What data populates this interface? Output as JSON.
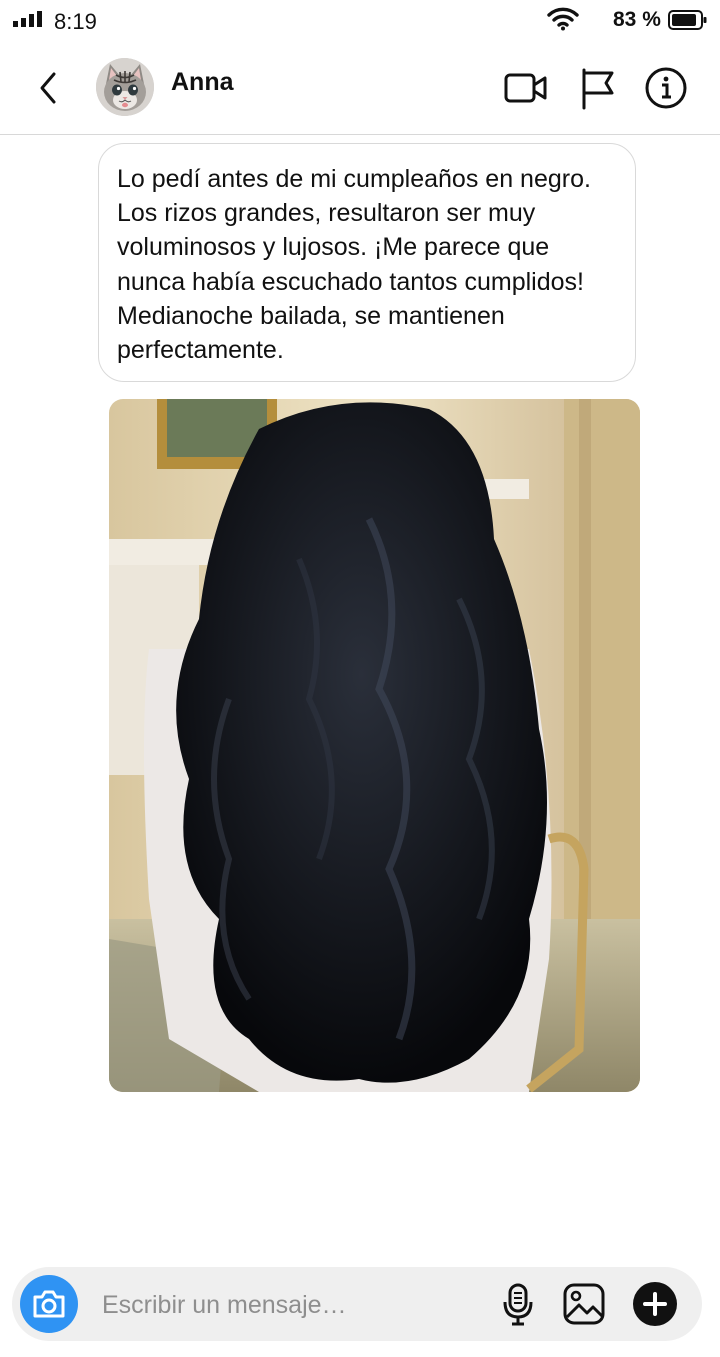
{
  "status_bar": {
    "time": "8:19",
    "battery_percent": "83 %",
    "icons": [
      "signal-icon",
      "wifi-icon",
      "battery-icon"
    ]
  },
  "header": {
    "contact_name": "Anna",
    "icons": [
      "back-arrow-icon",
      "video-call-icon",
      "flag-icon",
      "info-icon"
    ]
  },
  "message": {
    "text": "Lo pedí antes de mi cumpleaños en negro. Los rizos grandes, resultaron ser muy voluminosos y lujosos. ¡Me parece que nunca había escuchado tantos cumplidos! Medianoche bailada, se mantienen perfectamente."
  },
  "composer": {
    "placeholder": "Escribir un mensaje…",
    "value": "",
    "icons": [
      "camera-icon",
      "microphone-icon",
      "gallery-icon",
      "plus-icon"
    ]
  },
  "colors": {
    "accent": "#2f93f3",
    "border": "#d9d9d9",
    "composer_bg": "#efefef"
  }
}
